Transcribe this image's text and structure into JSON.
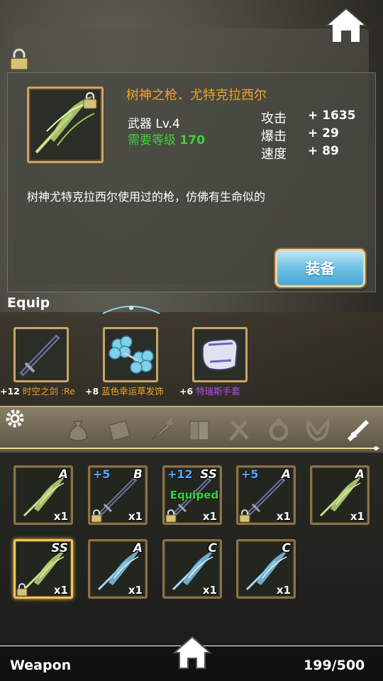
{
  "detail": {
    "name": "树神之枪．尤特克拉西尔",
    "type": "武器 Lv.4",
    "req_label": "需要等级",
    "req_value": "170",
    "stats": [
      {
        "label": "攻击",
        "value": "+ 1635"
      },
      {
        "label": "爆击",
        "value": "+ 29"
      },
      {
        "label": "速度",
        "value": "+ 89"
      }
    ],
    "description": "树神尤特克拉西尔使用过的枪，仿佛有生命似的",
    "equip_button": "装备"
  },
  "equip": {
    "title": "Equip",
    "slots": [
      {
        "plus": "+12",
        "name": "时空之剑 :Re"
      },
      {
        "plus": "+8",
        "name": "蓝色幸运草发饰"
      },
      {
        "plus": "+6",
        "name": "特瑞斯手套"
      }
    ]
  },
  "tabs": [
    "gear-icon",
    "bag-icon",
    "scroll-icon",
    "carrot-icon",
    "book-icon",
    "utensils-icon",
    "ring-icon",
    "ears-icon",
    "sword-icon"
  ],
  "inventory": [
    {
      "plus": "",
      "grade": "A",
      "count": "x1",
      "locked": false,
      "equipped": "",
      "art": "spear"
    },
    {
      "plus": "+5",
      "grade": "B",
      "count": "x1",
      "locked": true,
      "equipped": "",
      "art": "sword"
    },
    {
      "plus": "+12",
      "grade": "SS",
      "count": "x1",
      "locked": true,
      "equipped": "Equiped",
      "art": "sword"
    },
    {
      "plus": "+5",
      "grade": "A",
      "count": "x1",
      "locked": true,
      "equipped": "",
      "art": "sword"
    },
    {
      "plus": "",
      "grade": "A",
      "count": "x1",
      "locked": false,
      "equipped": "",
      "art": "spear"
    },
    {
      "plus": "",
      "grade": "SS",
      "count": "x1",
      "locked": true,
      "equipped": "",
      "art": "spear"
    },
    {
      "plus": "",
      "grade": "A",
      "count": "x1",
      "locked": false,
      "equipped": "",
      "art": "ice"
    },
    {
      "plus": "",
      "grade": "C",
      "count": "x1",
      "locked": false,
      "equipped": "",
      "art": "ice"
    },
    {
      "plus": "",
      "grade": "C",
      "count": "x1",
      "locked": false,
      "equipped": "",
      "art": "ice"
    }
  ],
  "footer": {
    "category": "Weapon",
    "capacity": "199/500"
  },
  "colors": {
    "gold_frame": "#c8a468",
    "name_orange": "#f4a12a",
    "green": "#3ad23a",
    "purple": "#b04ff0",
    "plus_blue": "#5aa7ff"
  }
}
